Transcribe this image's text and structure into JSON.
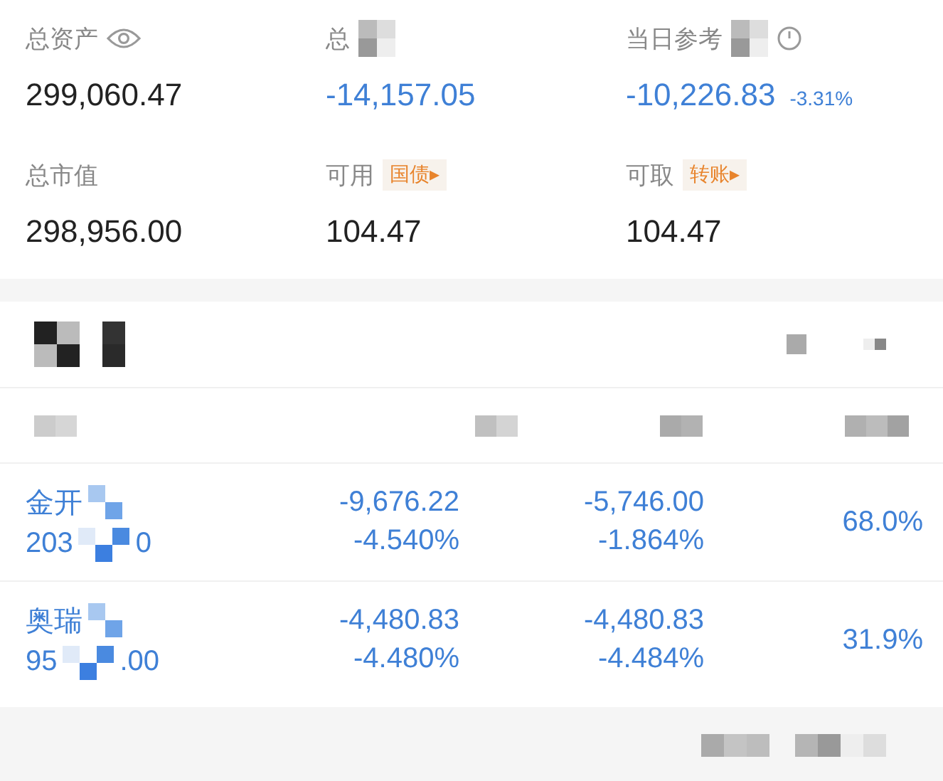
{
  "summary": [
    {
      "label": "总资产",
      "value": "299,060.47",
      "loss": false
    },
    {
      "label": "总",
      "value": "-14,157.05",
      "loss": true
    },
    {
      "label": "当日参考",
      "value": "-10,226.83",
      "loss": true,
      "change": "-3.31%"
    },
    {
      "label": "总市值",
      "value": "298,956.00",
      "loss": false
    },
    {
      "label": "可用",
      "tag": "国债",
      "tag_arrow": "▸",
      "value": "104.47",
      "loss": false
    },
    {
      "label": "可取",
      "tag": "转账",
      "tag_arrow": "▸",
      "value": "104.47",
      "loss": false
    }
  ],
  "holdings": [
    {
      "name": "金开",
      "line2_start": "203",
      "line2_end": "0",
      "pl": "-9,676.22",
      "pl_pct": "-4.540%",
      "day_pl": "-5,746.00",
      "day_pct": "-1.864%",
      "weight": "68.0%"
    },
    {
      "name": "奥瑞",
      "line2_start": "95",
      "line2_end": ".00",
      "pl": "-4,480.83",
      "pl_pct": "-4.480%",
      "day_pl": "-4,480.83",
      "day_pct": "-4.484%",
      "weight": "31.9%"
    }
  ]
}
